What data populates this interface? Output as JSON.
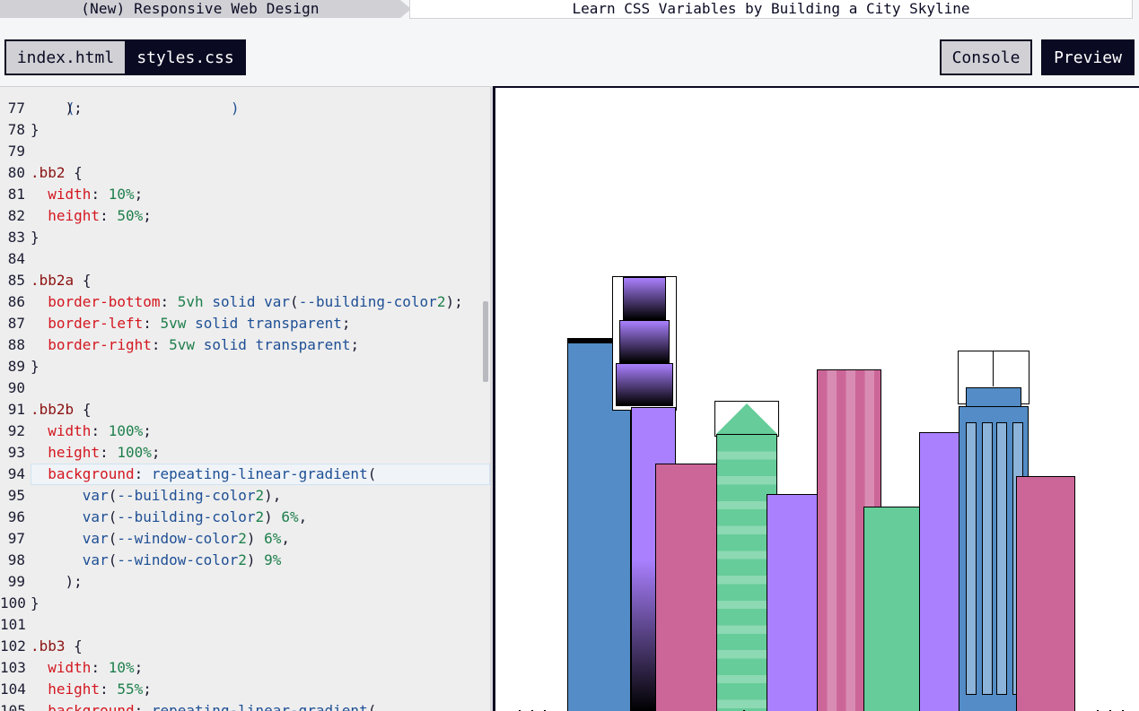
{
  "breadcrumb": {
    "course": "(New) Responsive Web Design",
    "lesson": "Learn CSS Variables by Building a City Skyline"
  },
  "tabs": {
    "index": "index.html",
    "styles": "styles.css"
  },
  "actions": {
    "console": "Console",
    "preview": "Preview"
  },
  "editor": {
    "active_line": "94",
    "lines": [
      {
        "n": "77",
        "code": "    );"
      },
      {
        "n": "78",
        "code": "}"
      },
      {
        "n": "79",
        "code": ""
      },
      {
        "n": "80",
        "code": ".bb2 {"
      },
      {
        "n": "81",
        "code": "  width: 10%;"
      },
      {
        "n": "82",
        "code": "  height: 50%;"
      },
      {
        "n": "83",
        "code": "}"
      },
      {
        "n": "84",
        "code": ""
      },
      {
        "n": "85",
        "code": ".bb2a {"
      },
      {
        "n": "86",
        "code": "  border-bottom: 5vh solid var(--building-color2);"
      },
      {
        "n": "87",
        "code": "  border-left: 5vw solid transparent;"
      },
      {
        "n": "88",
        "code": "  border-right: 5vw solid transparent;"
      },
      {
        "n": "89",
        "code": "}"
      },
      {
        "n": "90",
        "code": ""
      },
      {
        "n": "91",
        "code": ".bb2b {"
      },
      {
        "n": "92",
        "code": "  width: 100%;"
      },
      {
        "n": "93",
        "code": "  height: 100%;"
      },
      {
        "n": "94",
        "code": "  background: repeating-linear-gradient("
      },
      {
        "n": "95",
        "code": "      var(--building-color2),"
      },
      {
        "n": "96",
        "code": "      var(--building-color2) 6%,"
      },
      {
        "n": "97",
        "code": "      var(--window-color2) 6%,"
      },
      {
        "n": "98",
        "code": "      var(--window-color2) 9%"
      },
      {
        "n": "99",
        "code": "    );"
      },
      {
        "n": "100",
        "code": "}"
      },
      {
        "n": "101",
        "code": ""
      },
      {
        "n": "102",
        "code": ".bb3 {"
      },
      {
        "n": "103",
        "code": "  width: 10%;"
      },
      {
        "n": "104",
        "code": "  height: 55%;"
      },
      {
        "n": "105",
        "code": "  background: repeating-linear-gradient("
      }
    ]
  },
  "colors": {
    "building_color1": "#aa80ff",
    "building_color2": "#66cc99",
    "building_color3": "#cc6699",
    "building_color4": "#538cc6",
    "window_color1": "#bb99ff",
    "window_color2": "#8cd9b3",
    "window_color3": "#d98cb3",
    "window_color4": "#8cb3d9",
    "ink": "#0a0a23"
  }
}
